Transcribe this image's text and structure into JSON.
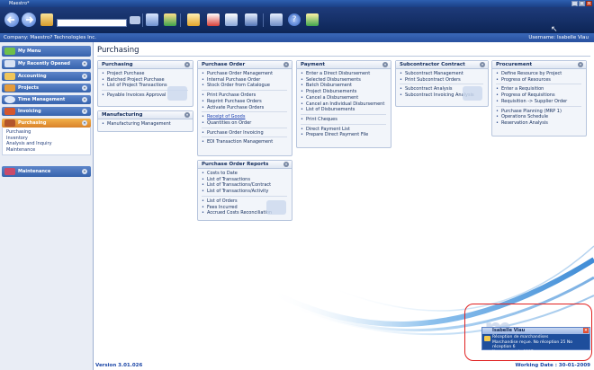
{
  "window": {
    "title": "Maestro*"
  },
  "info_bar": {
    "company": "Company: Maestro? Technologies Inc.",
    "username": "Username: Isabelle Viau"
  },
  "sidebar": {
    "items": [
      {
        "label": "My Menu",
        "icon": "star-icon"
      },
      {
        "label": "My Recently Opened",
        "icon": "recent-icon"
      },
      {
        "label": "Accounting",
        "icon": "accounting-icon"
      },
      {
        "label": "Projects",
        "icon": "projects-icon"
      },
      {
        "label": "Time Management",
        "icon": "clock-icon"
      },
      {
        "label": "Invoicing",
        "icon": "invoice-icon"
      },
      {
        "label": "Purchasing",
        "icon": "purchasing-icon"
      },
      {
        "label": "Maintenance",
        "icon": "maintenance-icon"
      }
    ],
    "purchasing_sub": [
      "Purchasing",
      "Inventory",
      "Analysis and Inquiry",
      "Maintenance"
    ]
  },
  "page": {
    "title": "Purchasing"
  },
  "panels": {
    "purchasing": {
      "title": "Purchasing",
      "items": [
        "Project Purchase",
        "Batched Project Purchase",
        "List of Project Transactions",
        "Payable Invoices Approval"
      ]
    },
    "manufacturing": {
      "title": "Manufacturing",
      "items": [
        "Manufacturing Management"
      ]
    },
    "purchase_order": {
      "title": "Purchase Order",
      "items": [
        "Purchase Order Management",
        "Internal Purchase Order",
        "Stock Order from Catalogue",
        "Print Purchase Orders",
        "Reprint Purchase Orders",
        "Activate Purchase Orders",
        "Receipt of Goods",
        "Quantities on Order",
        "Purchase Order Invoicing",
        "EDI Transaction Management"
      ]
    },
    "purchase_order_reports": {
      "title": "Purchase Order Reports",
      "items": [
        "Costs to Date",
        "List of Transactions",
        "List of Transactions/Contract",
        "List of Transactions/Activity",
        "List of Orders",
        "Fees Incurred",
        "Accrued Costs Reconciliation"
      ]
    },
    "payment": {
      "title": "Payment",
      "items": [
        "Enter a Direct Disbursement",
        "Selected Disbursements",
        "Batch Disbursement",
        "Project Disbursements",
        "Cancel a Disbursement",
        "Cancel an Individual Disbursement",
        "List of Disbursements",
        "Print Cheques",
        "Direct Payment List",
        "Prepare Direct Payment File"
      ]
    },
    "subcontractor": {
      "title": "Subcontractor Contract",
      "items": [
        "Subcontract Management",
        "Print Subcontract Orders",
        "Subcontract Analysis",
        "Subcontract Invoicing Analysis"
      ]
    },
    "procurement": {
      "title": "Procurement",
      "items": [
        "Define Resource by Project",
        "Progress of Resources",
        "Enter a Requisition",
        "Progress of Requisitions",
        "Requisition -> Supplier Order",
        "Purchase Planning (MRP 1)",
        "Operations Schedule",
        "Reservation Analysis"
      ]
    }
  },
  "notification": {
    "user": "Isabelle Viau",
    "line1": "Réception de marchandises",
    "line2": "Marchandise reçue. No réception 25 No réception 6",
    "line3": "No commande 8987"
  },
  "watermark": "m",
  "footer": {
    "version": "Version 3.01.026",
    "working_date": "Working Date : 30-01-2009"
  },
  "colors": {
    "toolbar": "#0d2556",
    "infobar": "#27509f",
    "accent": "#3663ad",
    "alert_ring": "#e02020"
  }
}
